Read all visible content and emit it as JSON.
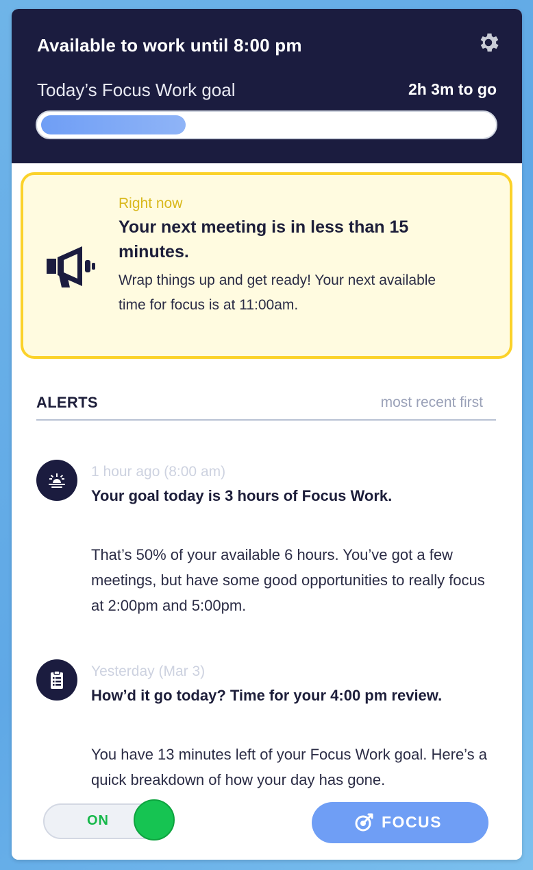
{
  "header": {
    "availability": "Available to work until 8:00 pm",
    "goal_label": "Today’s Focus Work goal",
    "time_to_go": "2h 3m to go",
    "progress_fraction": 0.32
  },
  "right_now": {
    "label": "Right now",
    "title": "Your next meeting is in less than 15 minutes.",
    "body": "Wrap things up and get ready! Your next available time for focus is at 11:00am."
  },
  "alerts": {
    "heading": "ALERTS",
    "sort_label": "most recent first",
    "items": [
      {
        "icon": "sunrise-icon",
        "time": "1 hour ago (8:00 am)",
        "title": "Your goal today is 3 hours of Focus Work.",
        "body": "That’s 50% of your available 6 hours. You’ve got a few meetings, but have some good opportunities to really focus at 2:00pm and 5:00pm."
      },
      {
        "icon": "clipboard-icon",
        "time": "Yesterday (Mar 3)",
        "title": "How’d it go today? Time for your 4:00 pm review.",
        "body": "You have 13 minutes left of your Focus Work goal. Here’s a quick breakdown of how your day has gone."
      }
    ]
  },
  "footer": {
    "toggle_label": "ON",
    "focus_label": "FOCUS"
  },
  "colors": {
    "header_bg": "#1b1c3f",
    "accent_blue": "#6f9ef5",
    "alert_yellow": "#fbd22a",
    "toggle_green": "#16c452"
  }
}
